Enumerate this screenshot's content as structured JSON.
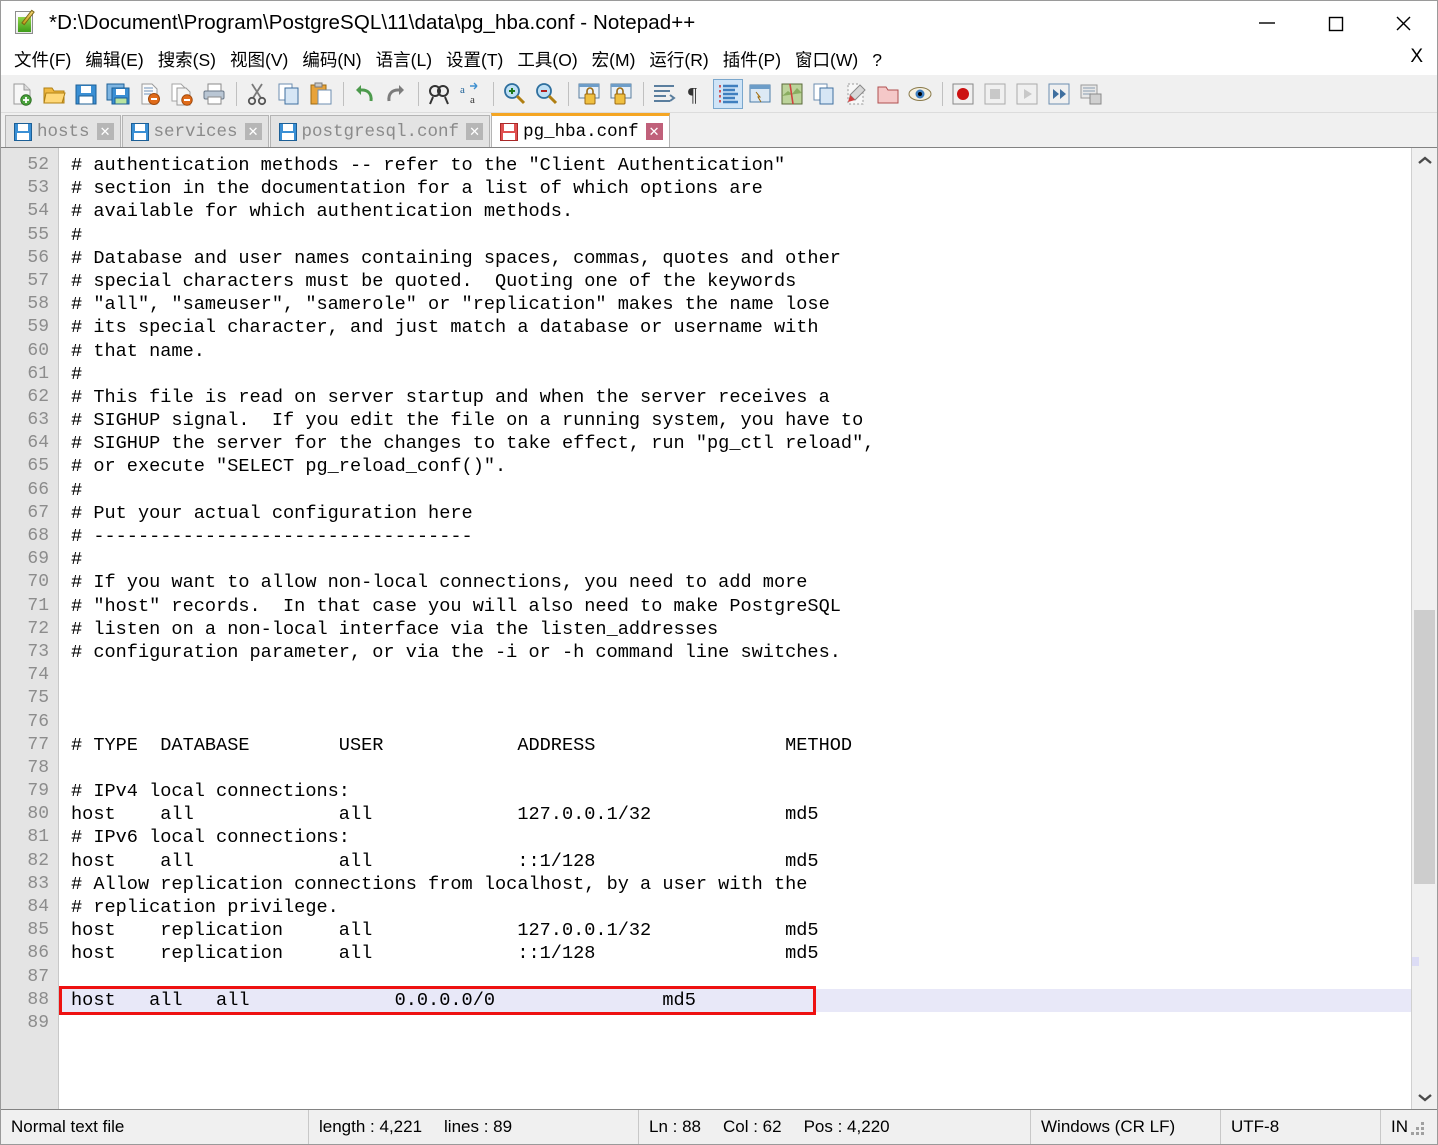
{
  "window": {
    "title": "*D:\\Document\\Program\\PostgreSQL\\11\\data\\pg_hba.conf - Notepad++",
    "minimize_label": "minimize",
    "maximize_label": "maximize",
    "close_label": "close"
  },
  "menu": {
    "items": [
      "文件(F)",
      "编辑(E)",
      "搜索(S)",
      "视图(V)",
      "编码(N)",
      "语言(L)",
      "设置(T)",
      "工具(O)",
      "宏(M)",
      "运行(R)",
      "插件(P)",
      "窗口(W)",
      "?"
    ],
    "close_doc": "X"
  },
  "toolbar": {
    "buttons": [
      "new-file",
      "open-file",
      "save",
      "save-all",
      "close-file",
      "close-all",
      "print",
      "cut",
      "copy",
      "paste",
      "undo",
      "redo",
      "find",
      "replace",
      "zoom-in",
      "zoom-out",
      "sync-vertical-scroll",
      "sync-horizontal-scroll",
      "word-wrap",
      "show-all-characters",
      "indent-guide",
      "user-defined-dialog",
      "document-map",
      "function-list",
      "folder-as-workspace",
      "monitoring",
      "record-macro",
      "stop-recording",
      "play-macro",
      "run-macro-multiple",
      "save-macro"
    ]
  },
  "tabs": [
    {
      "label": "hosts",
      "active": false,
      "modified": false
    },
    {
      "label": "services",
      "active": false,
      "modified": false
    },
    {
      "label": "postgresql.conf",
      "active": false,
      "modified": false
    },
    {
      "label": "pg_hba.conf",
      "active": true,
      "modified": true
    }
  ],
  "editor": {
    "first_line": 52,
    "current_line": 88,
    "lines": [
      {
        "n": 52,
        "text": "# authentication methods -- refer to the \"Client Authentication\""
      },
      {
        "n": 53,
        "text": "# section in the documentation for a list of which options are"
      },
      {
        "n": 54,
        "text": "# available for which authentication methods."
      },
      {
        "n": 55,
        "text": "#"
      },
      {
        "n": 56,
        "text": "# Database and user names containing spaces, commas, quotes and other"
      },
      {
        "n": 57,
        "text": "# special characters must be quoted.  Quoting one of the keywords"
      },
      {
        "n": 58,
        "text": "# \"all\", \"sameuser\", \"samerole\" or \"replication\" makes the name lose"
      },
      {
        "n": 59,
        "text": "# its special character, and just match a database or username with"
      },
      {
        "n": 60,
        "text": "# that name."
      },
      {
        "n": 61,
        "text": "#"
      },
      {
        "n": 62,
        "text": "# This file is read on server startup and when the server receives a"
      },
      {
        "n": 63,
        "text": "# SIGHUP signal.  If you edit the file on a running system, you have to"
      },
      {
        "n": 64,
        "text": "# SIGHUP the server for the changes to take effect, run \"pg_ctl reload\","
      },
      {
        "n": 65,
        "text": "# or execute \"SELECT pg_reload_conf()\"."
      },
      {
        "n": 66,
        "text": "#"
      },
      {
        "n": 67,
        "text": "# Put your actual configuration here"
      },
      {
        "n": 68,
        "text": "# ----------------------------------"
      },
      {
        "n": 69,
        "text": "#"
      },
      {
        "n": 70,
        "text": "# If you want to allow non-local connections, you need to add more"
      },
      {
        "n": 71,
        "text": "# \"host\" records.  In that case you will also need to make PostgreSQL"
      },
      {
        "n": 72,
        "text": "# listen on a non-local interface via the listen_addresses"
      },
      {
        "n": 73,
        "text": "# configuration parameter, or via the -i or -h command line switches."
      },
      {
        "n": 74,
        "text": ""
      },
      {
        "n": 75,
        "text": ""
      },
      {
        "n": 76,
        "text": ""
      },
      {
        "n": 77,
        "text": "# TYPE  DATABASE        USER            ADDRESS                 METHOD"
      },
      {
        "n": 78,
        "text": ""
      },
      {
        "n": 79,
        "text": "# IPv4 local connections:"
      },
      {
        "n": 80,
        "text": "host    all             all             127.0.0.1/32            md5"
      },
      {
        "n": 81,
        "text": "# IPv6 local connections:"
      },
      {
        "n": 82,
        "text": "host    all             all             ::1/128                 md5"
      },
      {
        "n": 83,
        "text": "# Allow replication connections from localhost, by a user with the"
      },
      {
        "n": 84,
        "text": "# replication privilege."
      },
      {
        "n": 85,
        "text": "host    replication     all             127.0.0.1/32            md5"
      },
      {
        "n": 86,
        "text": "host    replication     all             ::1/128                 md5"
      },
      {
        "n": 87,
        "text": ""
      },
      {
        "n": 88,
        "text": "host   all   all             0.0.0.0/0               md5"
      },
      {
        "n": 89,
        "text": ""
      }
    ],
    "annotation": {
      "type": "red-rectangle",
      "target_line": 88,
      "color": "#ee1111"
    },
    "current_line_color": "#e8e8f8"
  },
  "statusbar": {
    "file_type": "Normal text file",
    "length_label": "length : 4,221",
    "lines_label": "lines : 89",
    "ln": "Ln : 88",
    "col": "Col : 62",
    "pos": "Pos : 4,220",
    "eol": "Windows (CR LF)",
    "encoding": "UTF-8",
    "insert_mode": "IN"
  }
}
